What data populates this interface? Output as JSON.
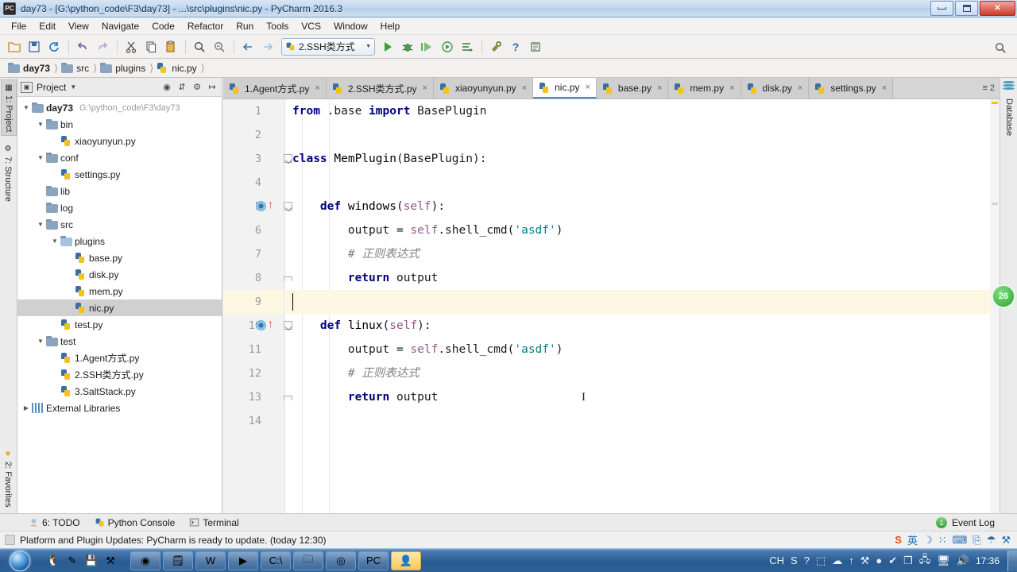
{
  "window": {
    "title": "day73 - [G:\\python_code\\F3\\day73] - ...\\src\\plugins\\nic.py - PyCharm 2016.3",
    "app_icon_label": "PC",
    "minimize_label": "Minimize",
    "maximize_label": "Maximize",
    "close_label": "Close"
  },
  "menubar": {
    "items": [
      {
        "label": "File"
      },
      {
        "label": "Edit"
      },
      {
        "label": "View"
      },
      {
        "label": "Navigate"
      },
      {
        "label": "Code"
      },
      {
        "label": "Refactor"
      },
      {
        "label": "Run"
      },
      {
        "label": "Tools"
      },
      {
        "label": "VCS"
      },
      {
        "label": "Window"
      },
      {
        "label": "Help"
      }
    ]
  },
  "toolbar": {
    "buttons": [
      {
        "name": "open-button",
        "glyph": "▭"
      },
      {
        "name": "save-all-button",
        "glyph": "⬓"
      },
      {
        "name": "sync-button",
        "glyph": "↺"
      },
      {
        "name": "undo-button",
        "glyph": "↶"
      },
      {
        "name": "redo-button",
        "glyph": "↷"
      },
      {
        "name": "cut-button",
        "glyph": "✂"
      },
      {
        "name": "copy-button",
        "glyph": "❐"
      },
      {
        "name": "paste-button",
        "glyph": "Ὄb"
      },
      {
        "name": "find-button",
        "glyph": "⌕"
      },
      {
        "name": "replace-button",
        "glyph": "⌕"
      },
      {
        "name": "back-button",
        "glyph": "←"
      },
      {
        "name": "forward-button",
        "glyph": "→"
      }
    ],
    "run_config": "2.SSH类方式",
    "run_buttons": [
      {
        "name": "run-button",
        "glyph": "▶"
      },
      {
        "name": "debug-button",
        "glyph": "🐞"
      },
      {
        "name": "coverage-button",
        "glyph": "▶"
      },
      {
        "name": "profile-button",
        "glyph": "▶"
      },
      {
        "name": "run-with-console-button",
        "glyph": "⇥"
      },
      {
        "name": "settings-button",
        "glyph": "⚒"
      },
      {
        "name": "help-button",
        "glyph": "?"
      },
      {
        "name": "attach-button",
        "glyph": "⚙"
      }
    ],
    "search_everywhere": "⌕"
  },
  "breadcrumb": {
    "items": [
      {
        "label": "day73",
        "type": "project",
        "active": true
      },
      {
        "label": "src",
        "type": "folder",
        "active": false
      },
      {
        "label": "plugins",
        "type": "folder",
        "active": false
      },
      {
        "label": "nic.py",
        "type": "file",
        "active": false
      }
    ]
  },
  "left_strip": {
    "tabs": [
      {
        "label": "1: Project",
        "selected": true
      },
      {
        "label": "7: Structure",
        "selected": false
      },
      {
        "label": "2: Favorites",
        "selected": false
      }
    ]
  },
  "right_strip": {
    "tabs": [
      {
        "label": "Database",
        "selected": false
      }
    ]
  },
  "project_panel": {
    "title": "Project",
    "actions": [
      "target-icon",
      "collapse-all-icon",
      "gear-icon",
      "hide-icon"
    ],
    "tree": [
      {
        "depth": 0,
        "twist": "▼",
        "icon": "folder",
        "label": "day73",
        "bold": true,
        "path": "G:\\python_code\\F3\\day73",
        "selected": false
      },
      {
        "depth": 1,
        "twist": "▼",
        "icon": "folder",
        "label": "bin",
        "bold": false,
        "path": "",
        "selected": false
      },
      {
        "depth": 2,
        "twist": "",
        "icon": "py",
        "label": "xiaoyunyun.py",
        "bold": false,
        "path": "",
        "selected": false
      },
      {
        "depth": 1,
        "twist": "▼",
        "icon": "folder",
        "label": "conf",
        "bold": false,
        "path": "",
        "selected": false
      },
      {
        "depth": 2,
        "twist": "",
        "icon": "py",
        "label": "settings.py",
        "bold": false,
        "path": "",
        "selected": false
      },
      {
        "depth": 1,
        "twist": "",
        "icon": "folder",
        "label": "lib",
        "bold": false,
        "path": "",
        "selected": false
      },
      {
        "depth": 1,
        "twist": "",
        "icon": "folder",
        "label": "log",
        "bold": false,
        "path": "",
        "selected": false
      },
      {
        "depth": 1,
        "twist": "▼",
        "icon": "folder",
        "label": "src",
        "bold": false,
        "path": "",
        "selected": false
      },
      {
        "depth": 2,
        "twist": "▼",
        "icon": "folder-src",
        "label": "plugins",
        "bold": false,
        "path": "",
        "selected": false
      },
      {
        "depth": 3,
        "twist": "",
        "icon": "py",
        "label": "base.py",
        "bold": false,
        "path": "",
        "selected": false
      },
      {
        "depth": 3,
        "twist": "",
        "icon": "py",
        "label": "disk.py",
        "bold": false,
        "path": "",
        "selected": false
      },
      {
        "depth": 3,
        "twist": "",
        "icon": "py",
        "label": "mem.py",
        "bold": false,
        "path": "",
        "selected": false
      },
      {
        "depth": 3,
        "twist": "",
        "icon": "py",
        "label": "nic.py",
        "bold": false,
        "path": "",
        "selected": true
      },
      {
        "depth": 2,
        "twist": "",
        "icon": "py",
        "label": "test.py",
        "bold": false,
        "path": "",
        "selected": false
      },
      {
        "depth": 1,
        "twist": "▼",
        "icon": "folder",
        "label": "test",
        "bold": false,
        "path": "",
        "selected": false
      },
      {
        "depth": 2,
        "twist": "",
        "icon": "py",
        "label": "1.Agent方式.py",
        "bold": false,
        "path": "",
        "selected": false
      },
      {
        "depth": 2,
        "twist": "",
        "icon": "py",
        "label": "2.SSH类方式.py",
        "bold": false,
        "path": "",
        "selected": false
      },
      {
        "depth": 2,
        "twist": "",
        "icon": "py",
        "label": "3.SaltStack.py",
        "bold": false,
        "path": "",
        "selected": false
      },
      {
        "depth": 0,
        "twist": "▶",
        "icon": "lib",
        "label": "External Libraries",
        "bold": false,
        "path": "",
        "selected": false
      }
    ]
  },
  "editor_tabs": {
    "tabs": [
      {
        "label": "1.Agent方式.py",
        "active": false
      },
      {
        "label": "2.SSH类方式.py",
        "active": false
      },
      {
        "label": "xiaoyunyun.py",
        "active": false
      },
      {
        "label": "nic.py",
        "active": true
      },
      {
        "label": "base.py",
        "active": false
      },
      {
        "label": "mem.py",
        "active": false
      },
      {
        "label": "disk.py",
        "active": false
      },
      {
        "label": "settings.py",
        "active": false
      }
    ],
    "close_glyph": "×",
    "overflow_count": "2",
    "overflow_glyph": "≡"
  },
  "editor": {
    "lines": [
      {
        "num": "1",
        "caret": false,
        "gutter": {
          "run": false,
          "fold": ""
        },
        "tokens": [
          {
            "t": "from",
            "c": "kw"
          },
          {
            "t": " ",
            "c": ""
          },
          {
            "t": ".base",
            "c": ""
          },
          {
            "t": " ",
            "c": ""
          },
          {
            "t": "import",
            "c": "kw"
          },
          {
            "t": " ",
            "c": ""
          },
          {
            "t": "BasePlugin",
            "c": ""
          }
        ]
      },
      {
        "num": "2",
        "caret": false,
        "gutter": {
          "run": false,
          "fold": ""
        },
        "tokens": []
      },
      {
        "num": "3",
        "caret": false,
        "gutter": {
          "run": false,
          "fold": "open"
        },
        "tokens": [
          {
            "t": "class",
            "c": "kw"
          },
          {
            "t": " ",
            "c": ""
          },
          {
            "t": "MemPlugin",
            "c": "cls"
          },
          {
            "t": "(BasePlugin):",
            "c": ""
          }
        ]
      },
      {
        "num": "4",
        "caret": false,
        "gutter": {
          "run": false,
          "fold": ""
        },
        "tokens": []
      },
      {
        "num": "5",
        "caret": false,
        "gutter": {
          "run": true,
          "fold": "open"
        },
        "tokens": [
          {
            "t": "    ",
            "c": ""
          },
          {
            "t": "def",
            "c": "kw"
          },
          {
            "t": " ",
            "c": ""
          },
          {
            "t": "windows",
            "c": "fn"
          },
          {
            "t": "(",
            "c": ""
          },
          {
            "t": "self",
            "c": "self"
          },
          {
            "t": "):",
            "c": ""
          }
        ]
      },
      {
        "num": "6",
        "caret": false,
        "gutter": {
          "run": false,
          "fold": ""
        },
        "tokens": [
          {
            "t": "        output = ",
            "c": ""
          },
          {
            "t": "self",
            "c": "self"
          },
          {
            "t": ".shell_cmd(",
            "c": ""
          },
          {
            "t": "'asdf'",
            "c": "str"
          },
          {
            "t": ")",
            "c": ""
          }
        ]
      },
      {
        "num": "7",
        "caret": false,
        "gutter": {
          "run": false,
          "fold": ""
        },
        "tokens": [
          {
            "t": "        # 正则表达式",
            "c": "cmt"
          }
        ]
      },
      {
        "num": "8",
        "caret": false,
        "gutter": {
          "run": false,
          "fold": "end"
        },
        "tokens": [
          {
            "t": "        ",
            "c": ""
          },
          {
            "t": "return",
            "c": "kw"
          },
          {
            "t": " output",
            "c": ""
          }
        ]
      },
      {
        "num": "9",
        "caret": true,
        "gutter": {
          "run": false,
          "fold": ""
        },
        "tokens": []
      },
      {
        "num": "10",
        "caret": false,
        "gutter": {
          "run": true,
          "fold": "open"
        },
        "tokens": [
          {
            "t": "    ",
            "c": ""
          },
          {
            "t": "def",
            "c": "kw"
          },
          {
            "t": " ",
            "c": ""
          },
          {
            "t": "linux",
            "c": "fn"
          },
          {
            "t": "(",
            "c": ""
          },
          {
            "t": "self",
            "c": "self"
          },
          {
            "t": "):",
            "c": ""
          }
        ]
      },
      {
        "num": "11",
        "caret": false,
        "gutter": {
          "run": false,
          "fold": ""
        },
        "tokens": [
          {
            "t": "        output = ",
            "c": ""
          },
          {
            "t": "self",
            "c": "self"
          },
          {
            "t": ".shell_cmd(",
            "c": ""
          },
          {
            "t": "'asdf'",
            "c": "str"
          },
          {
            "t": ")",
            "c": ""
          }
        ]
      },
      {
        "num": "12",
        "caret": false,
        "gutter": {
          "run": false,
          "fold": ""
        },
        "tokens": [
          {
            "t": "        # 正则表达式",
            "c": "cmt"
          }
        ]
      },
      {
        "num": "13",
        "caret": false,
        "gutter": {
          "run": false,
          "fold": "end"
        },
        "tokens": [
          {
            "t": "        ",
            "c": ""
          },
          {
            "t": "return",
            "c": "kw"
          },
          {
            "t": " output",
            "c": ""
          }
        ]
      },
      {
        "num": "14",
        "caret": false,
        "gutter": {
          "run": false,
          "fold": ""
        },
        "tokens": []
      }
    ],
    "text_cursor_glyph": "I"
  },
  "bottom_bar": {
    "items": [
      {
        "label": "6: TODO",
        "icon": "todo-icon"
      },
      {
        "label": "Python Console",
        "icon": "python-icon"
      },
      {
        "label": "Terminal",
        "icon": "terminal-icon"
      }
    ],
    "event_log": {
      "label": "Event Log",
      "count": "1"
    }
  },
  "status_bar": {
    "message": "Platform and Plugin Updates: PyCharm is ready to update. (today 12:30)",
    "tray": [
      "英",
      "☽",
      "⁙",
      "⌨",
      "⎘",
      "☂",
      "⚒"
    ]
  },
  "taskbar": {
    "start_label": "Start",
    "quick_launch": [
      {
        "name": "qq-icon",
        "glyph": "🐧"
      },
      {
        "name": "paint-icon",
        "glyph": "✎"
      },
      {
        "name": "save-icon",
        "glyph": "💾"
      },
      {
        "name": "tools-icon",
        "glyph": "⚒"
      }
    ],
    "windows": [
      {
        "name": "chrome-window",
        "glyph": "◉",
        "active": false
      },
      {
        "name": "notepad-window",
        "glyph": "🗒",
        "active": false
      },
      {
        "name": "word-window",
        "glyph": "W",
        "active": false
      },
      {
        "name": "media-window",
        "glyph": "▶",
        "active": false
      },
      {
        "name": "cmd-window",
        "glyph": "C:\\",
        "active": false
      },
      {
        "name": "explorer-window",
        "glyph": "🗀",
        "active": false
      },
      {
        "name": "camtasia-window",
        "glyph": "◎",
        "active": false
      },
      {
        "name": "pycharm-window",
        "glyph": "PC",
        "active": false
      },
      {
        "name": "current-window",
        "glyph": "👤",
        "active": true
      }
    ],
    "tray": [
      {
        "name": "ime-indicator",
        "glyph": "CH"
      },
      {
        "name": "sogou-icon",
        "glyph": "S"
      },
      {
        "name": "help-icon",
        "glyph": "?"
      },
      {
        "name": "show-hidden-icon",
        "glyph": "⬚"
      },
      {
        "name": "cloud-icon",
        "glyph": "☁"
      },
      {
        "name": "update-icon",
        "glyph": "↑"
      },
      {
        "name": "tools-tray-icon",
        "glyph": "⚒"
      },
      {
        "name": "record-icon",
        "glyph": "●"
      },
      {
        "name": "shield-icon",
        "glyph": "✔"
      },
      {
        "name": "window-icon",
        "glyph": "❐"
      },
      {
        "name": "network-icon",
        "glyph": "🖧"
      },
      {
        "name": "monitor-icon",
        "glyph": "🖥"
      },
      {
        "name": "volume-icon",
        "glyph": "🔊"
      }
    ],
    "clock": "17:36"
  },
  "overlay": {
    "recorder_count": "26"
  },
  "colors": {
    "accent": "#3f8cd4",
    "keyword": "#000080",
    "string": "#008080",
    "comment": "#808080",
    "self": "#94558d",
    "caretline": "#fdf7e2",
    "selection": "#d0d0d0"
  }
}
